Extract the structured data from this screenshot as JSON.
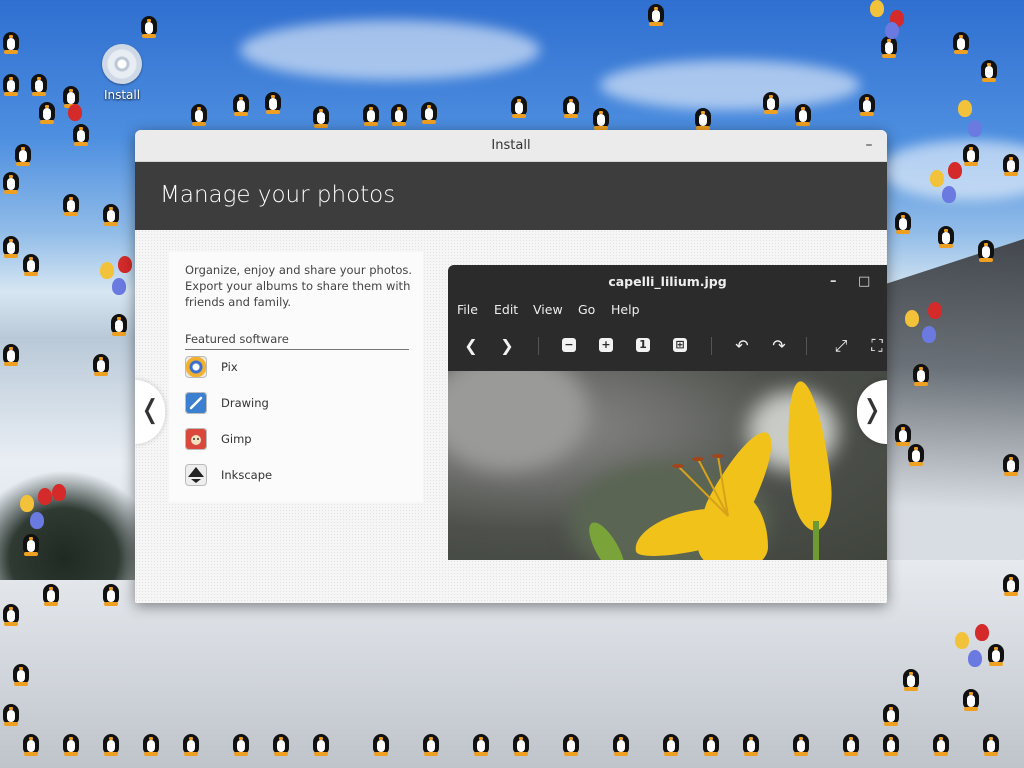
{
  "desktop": {
    "icon_label": "Install"
  },
  "window": {
    "title": "Install",
    "minimize_glyph": "–",
    "banner_title": "Manage your photos",
    "description": "Organize, enjoy and share your photos. Export your albums to share them with friends and family.",
    "featured_heading": "Featured software",
    "apps": [
      {
        "label": "Pix",
        "icon": "pix-icon",
        "color": "#e8a23a"
      },
      {
        "label": "Drawing",
        "icon": "drawing-icon",
        "color": "#3a7fd0"
      },
      {
        "label": "Gimp",
        "icon": "gimp-icon",
        "color": "#d9483b"
      },
      {
        "label": "Inkscape",
        "icon": "inkscape-icon",
        "color": "#333333"
      }
    ],
    "prev_glyph": "❬",
    "next_glyph": "❭"
  },
  "viewer": {
    "filename": "capelli_lilium.jpg",
    "minimize_glyph": "–",
    "maximize_glyph": "□",
    "menu": [
      "File",
      "Edit",
      "View",
      "Go",
      "Help"
    ],
    "toolbar": {
      "back": "❮",
      "forward": "❯",
      "zoom_out": "−",
      "zoom_in": "+",
      "zoom_one": "1",
      "zoom_fit": "⊞",
      "rotate_left": "↶",
      "rotate_right": "↷",
      "fullscreen": "⤢",
      "slideshow": "⛶"
    }
  },
  "colors": {
    "banner": "#3d3d3d",
    "viewer_bg": "#2b2b2b",
    "lily": "#f0c21a"
  }
}
